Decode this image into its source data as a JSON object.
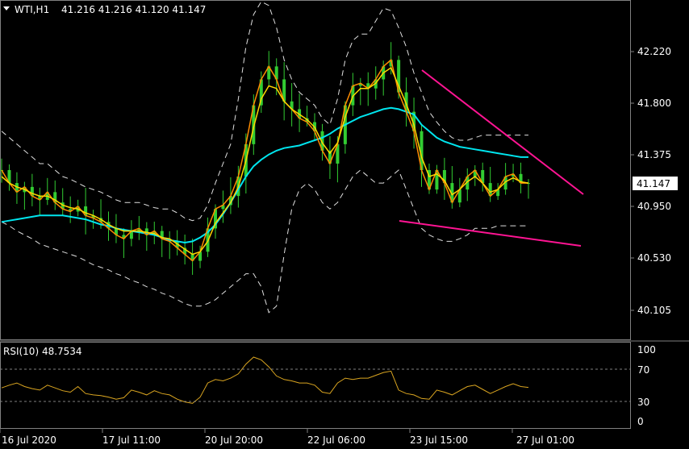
{
  "header": {
    "dropdown_icon": "triangle-down-icon",
    "symbol": "WTI,H1",
    "ohlc": "41.216 41.216 41.120 41.147"
  },
  "price_axis": {
    "ticks": [
      "42.220",
      "41.800",
      "41.375",
      "40.950",
      "40.530",
      "40.105"
    ],
    "current_price": "41.147"
  },
  "rsi": {
    "title": "RSI(10) 48.7534",
    "ticks": [
      "100",
      "70",
      "30",
      "0"
    ],
    "levels": [
      70,
      30
    ]
  },
  "time_axis": {
    "ticks": [
      "16 Jul 2020",
      "17 Jul 11:00",
      "20 Jul 20:00",
      "22 Jul 06:00",
      "23 Jul 15:00",
      "27 Jul 01:00"
    ]
  },
  "colors": {
    "background": "#000000",
    "candles": "#32cd32",
    "ma_fast": "#ff8c00",
    "ma_mid": "#ffd700",
    "ma_slow": "#00e5ee",
    "bollinger": "#e0e0e0",
    "trendline": "#ff1493",
    "rsi_line": "#daa520",
    "grid": "#808080"
  },
  "chart_data": {
    "type": "line",
    "title": "WTI,H1",
    "xlabel": "",
    "ylabel": "",
    "ylim": [
      39.95,
      42.55
    ],
    "series": [
      {
        "values": [
          41.25,
          41.15,
          41.08,
          41.12,
          41.05,
          41.02,
          41.08,
          41.0,
          40.95,
          40.93,
          40.97,
          40.9,
          40.88,
          40.85,
          40.8,
          40.75,
          40.72,
          40.78,
          40.8,
          40.75,
          40.78,
          40.72,
          40.7,
          40.65,
          40.6,
          40.55,
          40.62,
          40.8,
          40.95,
          40.98,
          41.05,
          41.2,
          41.45,
          41.75,
          41.95,
          42.05,
          41.95,
          41.78,
          41.72,
          41.65,
          41.62,
          41.55,
          41.4,
          41.3,
          41.45,
          41.75,
          41.9,
          41.92,
          41.88,
          41.95,
          42.05,
          42.1,
          41.85,
          41.7,
          41.55,
          41.25,
          41.1,
          41.25,
          41.15,
          41.0,
          41.1,
          41.2,
          41.25,
          41.15,
          41.05,
          41.1,
          41.2,
          41.22,
          41.15,
          41.15
        ]
      },
      {
        "values": [
          41.2,
          41.15,
          41.12,
          41.1,
          41.07,
          41.05,
          41.05,
          41.02,
          40.98,
          40.96,
          40.95,
          40.92,
          40.9,
          40.87,
          40.83,
          40.8,
          40.78,
          40.78,
          40.78,
          40.77,
          40.76,
          40.73,
          40.72,
          40.68,
          40.64,
          40.6,
          40.62,
          40.7,
          40.84,
          40.92,
          41.0,
          41.12,
          41.32,
          41.58,
          41.8,
          41.9,
          41.88,
          41.78,
          41.72,
          41.68,
          41.64,
          41.58,
          41.46,
          41.38,
          41.46,
          41.66,
          41.82,
          41.88,
          41.88,
          41.92,
          42.0,
          42.04,
          41.9,
          41.76,
          41.6,
          41.35,
          41.2,
          41.22,
          41.17,
          41.06,
          41.1,
          41.16,
          41.2,
          41.15,
          41.08,
          41.1,
          41.16,
          41.19,
          41.16,
          41.15
        ]
      },
      {
        "values": [
          40.85,
          40.86,
          40.87,
          40.88,
          40.89,
          40.9,
          40.9,
          40.9,
          40.9,
          40.89,
          40.88,
          40.87,
          40.85,
          40.83,
          40.82,
          40.8,
          40.79,
          40.78,
          40.77,
          40.76,
          40.75,
          40.73,
          40.71,
          40.7,
          40.69,
          40.7,
          40.73,
          40.77,
          40.83,
          40.91,
          41.0,
          41.1,
          41.2,
          41.28,
          41.33,
          41.37,
          41.4,
          41.42,
          41.43,
          41.44,
          41.46,
          41.48,
          41.5,
          41.53,
          41.57,
          41.6,
          41.63,
          41.66,
          41.68,
          41.7,
          41.72,
          41.73,
          41.72,
          41.7,
          41.68,
          41.6,
          41.55,
          41.5,
          41.47,
          41.45,
          41.43,
          41.42,
          41.41,
          41.4,
          41.39,
          41.38,
          41.37,
          41.36,
          41.35,
          41.35
        ]
      },
      {
        "values": [
          41.55,
          41.5,
          41.45,
          41.4,
          41.35,
          41.3,
          41.3,
          41.25,
          41.2,
          41.18,
          41.15,
          41.12,
          41.1,
          41.08,
          41.05,
          41.02,
          41.0,
          41.0,
          41.0,
          40.98,
          40.96,
          40.95,
          40.95,
          40.92,
          40.88,
          40.86,
          40.88,
          40.98,
          41.15,
          41.3,
          41.45,
          41.8,
          42.2,
          42.45,
          42.55,
          42.52,
          42.35,
          42.1,
          41.95,
          41.85,
          41.8,
          41.75,
          41.65,
          41.6,
          41.8,
          42.1,
          42.25,
          42.3,
          42.3,
          42.4,
          42.5,
          42.48,
          42.35,
          42.2,
          42.0,
          41.85,
          41.7,
          41.62,
          41.55,
          41.5,
          41.48,
          41.48,
          41.5,
          41.52,
          41.52,
          41.52,
          41.52,
          41.52,
          41.52,
          41.52
        ]
      },
      {
        "values": [
          40.85,
          40.82,
          40.78,
          40.75,
          40.72,
          40.68,
          40.66,
          40.64,
          40.62,
          40.6,
          40.58,
          40.55,
          40.52,
          40.5,
          40.48,
          40.45,
          40.43,
          40.4,
          40.38,
          40.35,
          40.33,
          40.3,
          40.28,
          40.25,
          40.22,
          40.2,
          40.2,
          40.22,
          40.25,
          40.3,
          40.35,
          40.4,
          40.45,
          40.45,
          40.35,
          40.15,
          40.2,
          40.6,
          40.95,
          41.1,
          41.15,
          41.1,
          41.0,
          40.95,
          41.0,
          41.1,
          41.2,
          41.25,
          41.2,
          41.15,
          41.15,
          41.2,
          41.25,
          41.1,
          40.95,
          40.8,
          40.75,
          40.72,
          40.7,
          40.7,
          40.72,
          40.75,
          40.8,
          40.8,
          40.8,
          40.82,
          40.82,
          40.82,
          40.82,
          40.82
        ]
      },
      {
        "values": [
          48,
          52,
          55,
          50,
          47,
          45,
          52,
          48,
          44,
          42,
          50,
          40,
          38,
          37,
          35,
          32,
          34,
          45,
          42,
          38,
          44,
          40,
          38,
          32,
          28,
          26,
          35,
          55,
          60,
          58,
          62,
          68,
          82,
          92,
          88,
          78,
          65,
          60,
          58,
          55,
          55,
          52,
          42,
          40,
          55,
          62,
          60,
          62,
          62,
          66,
          70,
          72,
          45,
          40,
          38,
          33,
          32,
          45,
          42,
          38,
          44,
          50,
          52,
          46,
          40,
          45,
          50,
          54,
          50,
          48.75
        ]
      }
    ]
  }
}
